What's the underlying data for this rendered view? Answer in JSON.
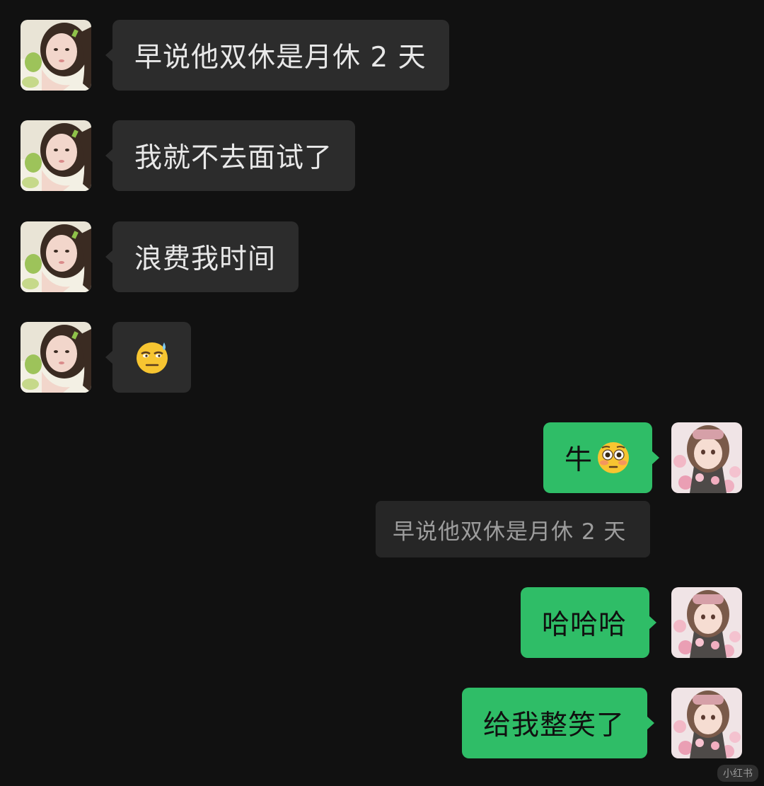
{
  "conversation": {
    "messages": [
      {
        "sender": "other",
        "text": "早说他双休是月休 2 天"
      },
      {
        "sender": "other",
        "text": "我就不去面试了"
      },
      {
        "sender": "other",
        "text": "浪费我时间"
      },
      {
        "sender": "other",
        "emoji": "sweat-smile-emoji"
      },
      {
        "sender": "self",
        "text": "牛",
        "emoji": "flushed-face-emoji"
      },
      {
        "sender": "self",
        "text": "哈哈哈"
      },
      {
        "sender": "self",
        "text": "给我整笑了"
      }
    ],
    "quote": {
      "text": "早说他双休是月休 2 天"
    }
  },
  "colors": {
    "background": "#111111",
    "incoming_bubble": "#2c2c2c",
    "outgoing_bubble": "#2fbd67",
    "quote_bubble": "#262626"
  },
  "watermark": {
    "text": "小红书"
  }
}
